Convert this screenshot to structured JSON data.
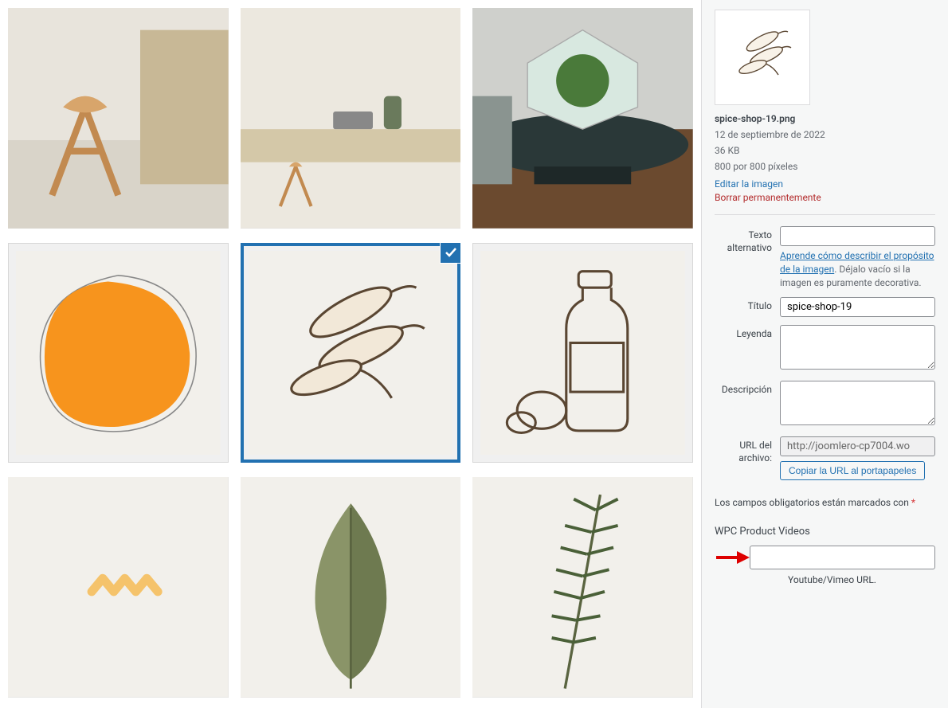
{
  "sidebar": {
    "filename": "spice-shop-19.png",
    "date": "12 de septiembre de 2022",
    "filesize": "36 KB",
    "dimensions": "800 por 800 píxeles",
    "edit_link": "Editar la imagen",
    "delete_link": "Borrar permanentemente",
    "labels": {
      "alt_text": "Texto alternativo",
      "alt_help_link": "Aprende cómo describir el propósito de la imagen",
      "alt_help_rest": ". Déjalo vacío si la imagen es puramente decorativa.",
      "title": "Título",
      "caption": "Leyenda",
      "description": "Descripción",
      "file_url": "URL del archivo:",
      "copy_url": "Copiar la URL al portapapeles",
      "required_note": "Los campos obligatorios están marcados con ",
      "wpc_section": "WPC Product Videos",
      "video_hint": "Youtube/Vimeo URL."
    },
    "values": {
      "alt_text": "",
      "title": "spice-shop-19",
      "caption": "",
      "description": "",
      "file_url": "http://joomlero-cp7004.wo",
      "video_url": ""
    }
  },
  "grid": {
    "selected_index": 4,
    "items": [
      {
        "name": "stool-photo"
      },
      {
        "name": "desk-photo"
      },
      {
        "name": "terrarium-photo"
      },
      {
        "name": "orange-blob"
      },
      {
        "name": "spice-sketch",
        "selected": true
      },
      {
        "name": "bottle-sketch"
      },
      {
        "name": "zigzag-pattern"
      },
      {
        "name": "leaf-photo"
      },
      {
        "name": "rosemary-photo"
      }
    ]
  }
}
